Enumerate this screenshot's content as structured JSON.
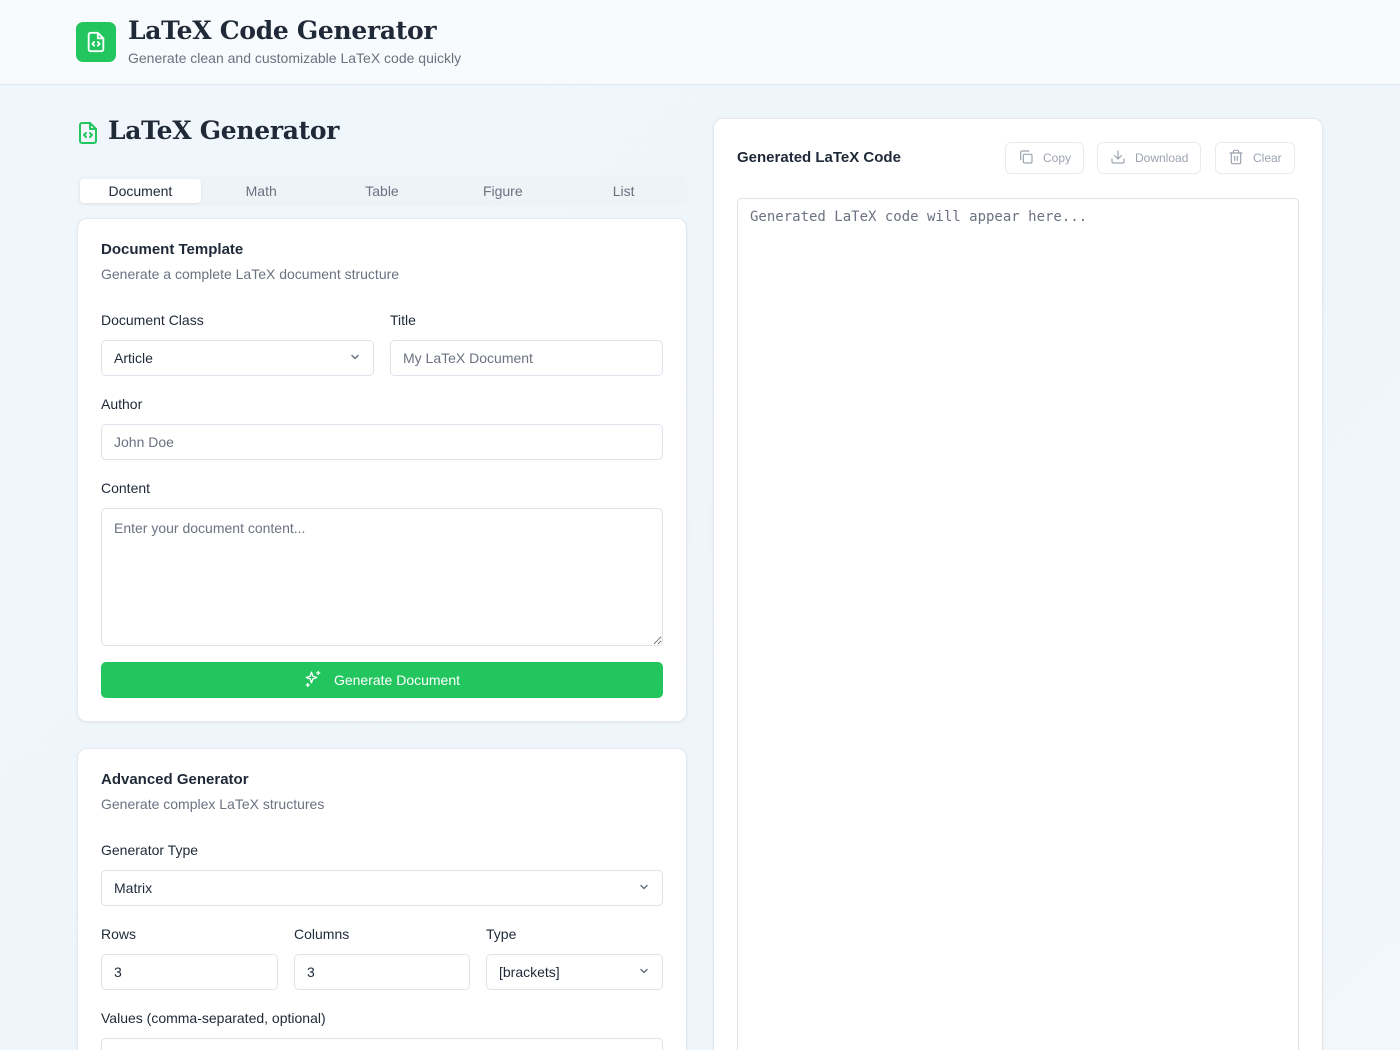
{
  "header": {
    "title": "LaTeX Code Generator",
    "subtitle": "Generate clean and customizable LaTeX code quickly"
  },
  "section_title": "LaTeX Generator",
  "tabs": [
    {
      "label": "Document",
      "active": true
    },
    {
      "label": "Math",
      "active": false
    },
    {
      "label": "Table",
      "active": false
    },
    {
      "label": "Figure",
      "active": false
    },
    {
      "label": "List",
      "active": false
    }
  ],
  "document_card": {
    "title": "Document Template",
    "description": "Generate a complete LaTeX document structure",
    "document_class_label": "Document Class",
    "document_class_value": "Article",
    "title_label": "Title",
    "title_placeholder": "My LaTeX Document",
    "author_label": "Author",
    "author_placeholder": "John Doe",
    "content_label": "Content",
    "content_placeholder": "Enter your document content...",
    "generate_label": "Generate Document"
  },
  "advanced_card": {
    "title": "Advanced Generator",
    "description": "Generate complex LaTeX structures",
    "generator_type_label": "Generator Type",
    "generator_type_value": "Matrix",
    "rows_label": "Rows",
    "rows_value": "3",
    "columns_label": "Columns",
    "columns_value": "3",
    "type_label": "Type",
    "type_value": "[brackets]",
    "values_label": "Values (comma-separated, optional)"
  },
  "output": {
    "title": "Generated LaTeX Code",
    "copy_label": "Copy",
    "download_label": "Download",
    "clear_label": "Clear",
    "placeholder": "Generated LaTeX code will appear here..."
  },
  "colors": {
    "accent": "#22c55e",
    "text": "#1f2937",
    "muted": "#6b7280",
    "border": "#dde3ea"
  }
}
